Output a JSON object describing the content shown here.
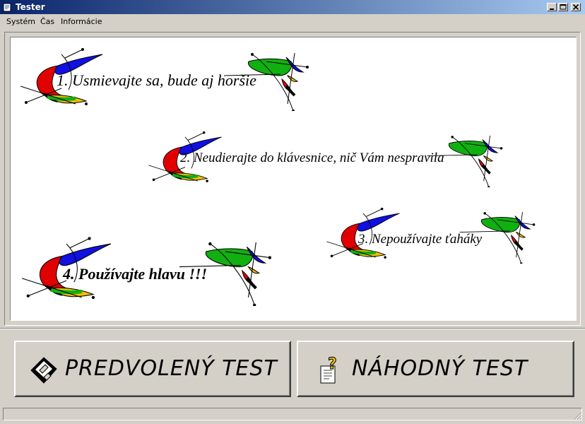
{
  "window": {
    "title": "Tester"
  },
  "menu": {
    "items": [
      "Systém",
      "Čas",
      "Informácie"
    ]
  },
  "rules": [
    "1. Usmievajte sa, bude aj horšie",
    "2. Neudierajte do klávesnice, nič Vám nespravila",
    "3. Nepoužívajte ťaháky",
    "4. Používajte hlavu !!!"
  ],
  "buttons": {
    "default_test": "PREDVOLENÝ TEST",
    "random_test": "NÁHODNÝ TEST"
  },
  "colors": {
    "titlebar": "#0a246a",
    "face": "#d4d0c8",
    "swirl_red": "#e00000",
    "swirl_blue": "#1010e0",
    "swirl_green": "#10b010",
    "swirl_yellow": "#f0c000"
  },
  "icons": {
    "app": "app-icon",
    "minimize": "minimize-icon",
    "maximize": "maximize-icon",
    "close": "close-icon",
    "floppy": "floppy-disk-icon",
    "question": "question-document-icon"
  }
}
